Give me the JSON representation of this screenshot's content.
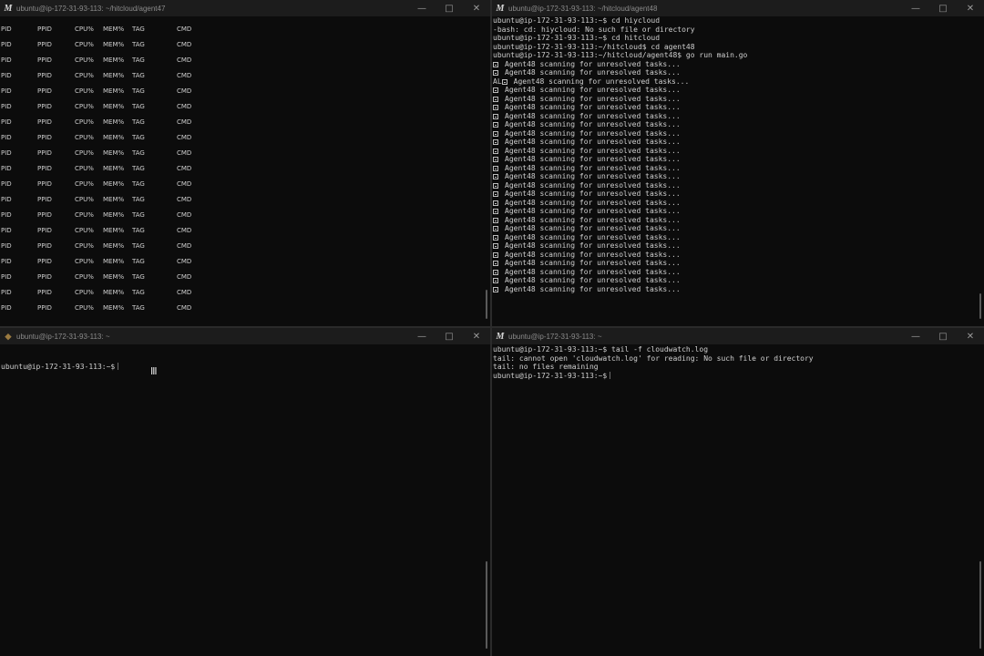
{
  "windows": {
    "top_left": {
      "title": "ubuntu@ip-172-31-93-113: ~/hitcloud/agent47",
      "app_icon": "M",
      "buttons": {
        "minimize": "—",
        "maximize": "□",
        "close": "✕"
      },
      "columns": [
        "PID",
        "PPID",
        "CPU%",
        "MEM%",
        "TAG",
        "CMD"
      ],
      "row_count": 19
    },
    "top_right": {
      "title": "ubuntu@ip-172-31-93-113: ~/hitcloud/agent48",
      "app_icon": "M",
      "buttons": {
        "minimize": "—",
        "maximize": "□",
        "close": "✕"
      },
      "lines": [
        "ubuntu@ip-172-31-93-113:~$ cd hiycloud",
        "-bash: cd: hiycloud: No such file or directory",
        "ubuntu@ip-172-31-93-113:~$ cd hitcloud",
        "ubuntu@ip-172-31-93-113:~/hitcloud$ cd agent48",
        "ubuntu@ip-172-31-93-113:~/hitcloud/agent48$ go run main.go"
      ],
      "scan_line": "Agent48 scanning for unresolved tasks...",
      "scan_prefix_special": "AL",
      "scan_count": 27
    },
    "bottom_left": {
      "title": "ubuntu@ip-172-31-93-113: ~",
      "app_icon": "mate-icon",
      "buttons": {
        "minimize": "—",
        "maximize": "□",
        "close": "✕"
      },
      "prompt": "ubuntu@ip-172-31-93-113:~$"
    },
    "bottom_right": {
      "title": "ubuntu@ip-172-31-93-113: ~",
      "app_icon": "M",
      "buttons": {
        "minimize": "—",
        "maximize": "□",
        "close": "✕"
      },
      "lines": [
        "ubuntu@ip-172-31-93-113:~$ tail -f cloudwatch.log",
        "tail: cannot open 'cloudwatch.log' for reading: No such file or directory",
        "tail: no files remaining"
      ],
      "prompt": "ubuntu@ip-172-31-93-113:~$"
    }
  }
}
